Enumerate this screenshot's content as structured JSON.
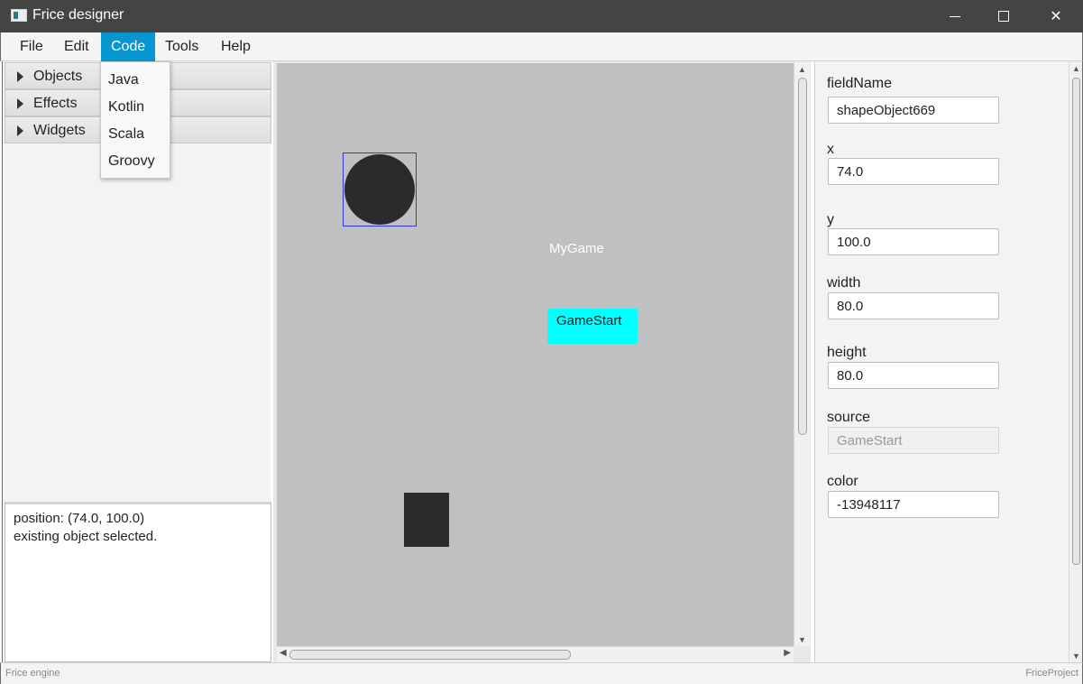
{
  "window": {
    "title": "Frice designer",
    "minimize_icon": "minimize-icon",
    "maximize_icon": "maximize-icon",
    "close_icon": "close-icon",
    "close_glyph": "✕"
  },
  "menubar": {
    "items": [
      "File",
      "Edit",
      "Code",
      "Tools",
      "Help"
    ],
    "active": "Code"
  },
  "code_menu": {
    "items": [
      "Java",
      "Kotlin",
      "Scala",
      "Groovy"
    ]
  },
  "left_panel": {
    "sections": [
      "Objects",
      "Effects",
      "Widgets"
    ],
    "log_lines": [
      "position: (74.0, 100.0)",
      "existing object selected."
    ]
  },
  "canvas": {
    "background": "#c0c0c0",
    "label_text": "MyGame",
    "button_text": "GameStart",
    "button_color": "#00ffff",
    "shape_color": "#2b2b2b",
    "selection_color": "#3434e8"
  },
  "properties": {
    "fieldName": {
      "label": "fieldName",
      "value": "shapeObject669"
    },
    "x": {
      "label": "x",
      "value": "74.0"
    },
    "y": {
      "label": "y",
      "value": "100.0"
    },
    "width": {
      "label": "width",
      "value": "80.0"
    },
    "height": {
      "label": "height",
      "value": "80.0"
    },
    "source": {
      "label": "source",
      "value": "GameStart"
    },
    "color": {
      "label": "color",
      "value": "-13948117"
    }
  },
  "statusbar": {
    "left": "Frice engine",
    "right": "FriceProject"
  },
  "accent": "#0896d0"
}
